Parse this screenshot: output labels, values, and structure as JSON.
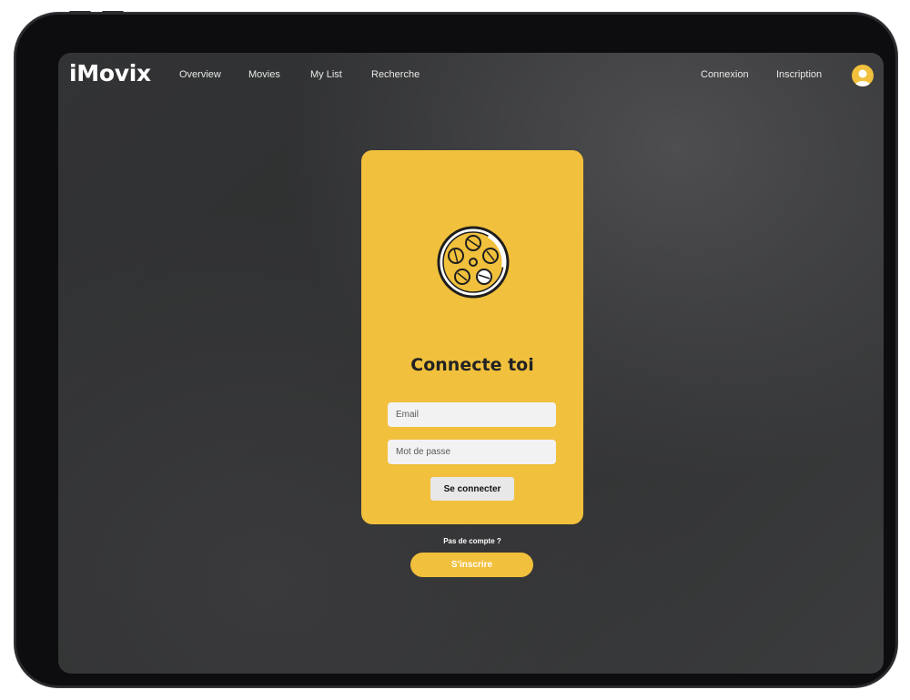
{
  "app": {
    "name": "iMovix"
  },
  "nav": {
    "links": [
      "Overview",
      "Movies",
      "My List",
      "Recherche"
    ],
    "auth_links": [
      "Connexion",
      "Inscription"
    ]
  },
  "login": {
    "title": "Connecte toi",
    "email_placeholder": "Email",
    "password_placeholder": "Mot de passe",
    "submit_label": "Se connecter"
  },
  "signup": {
    "prompt": "Pas de compte ?",
    "button_label": "S'inscrire"
  },
  "icons": {
    "logo": "film-reel-icon",
    "avatar": "user-avatar-icon"
  },
  "colors": {
    "accent": "#f1c03c",
    "background": "#2f3031",
    "text": "#ffffff"
  }
}
